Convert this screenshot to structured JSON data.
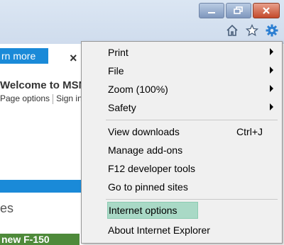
{
  "browser": {
    "window_controls": {
      "minimize_icon": "minimize-icon",
      "restore_icon": "restore-icon",
      "close_icon": "close-icon"
    },
    "toolbar": {
      "home_icon": "home-icon",
      "favorites_icon": "star-icon",
      "tools_icon": "gear-icon"
    }
  },
  "page": {
    "learn_more": "rn more",
    "close_glyph": "×",
    "welcome": "Welcome to MSN",
    "page_options": "Page options",
    "sign_in": "Sign in",
    "es_text": "es",
    "green_bar": "new F-150"
  },
  "menu": {
    "items": [
      {
        "label": "Print",
        "submenu": true
      },
      {
        "label": "File",
        "submenu": true
      },
      {
        "label": "Zoom (100%)",
        "submenu": true
      },
      {
        "label": "Safety",
        "submenu": true
      },
      {
        "label": "View downloads",
        "shortcut": "Ctrl+J"
      },
      {
        "label": "Manage add-ons"
      },
      {
        "label": "F12 developer tools"
      },
      {
        "label": "Go to pinned sites"
      },
      {
        "label": "Internet options",
        "highlighted": true
      },
      {
        "label": "About Internet Explorer"
      }
    ]
  },
  "colors": {
    "highlight": "#a9d9c6",
    "accent_blue": "#1a8ad8",
    "menu_bg": "#f0f0f0"
  }
}
